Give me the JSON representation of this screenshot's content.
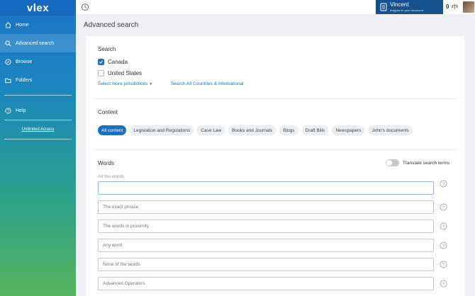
{
  "app": {
    "logo": "vlex"
  },
  "sidebar": {
    "items": [
      {
        "label": "Home",
        "icon": "home-icon"
      },
      {
        "label": "Advanced search",
        "icon": "search-icon",
        "active": true
      },
      {
        "label": "Browse",
        "icon": "compass-icon"
      },
      {
        "label": "Folders",
        "icon": "folder-icon"
      },
      {
        "label": "Help",
        "icon": "help-icon"
      }
    ],
    "unlimited_access": "Unlimited Access"
  },
  "header": {
    "user_name": "Vincent",
    "user_subtitle": "Insights on your document",
    "credits": "0"
  },
  "page_title": "Advanced search",
  "search": {
    "heading": "Search",
    "jurisdictions": [
      {
        "label": "Canada",
        "checked": true
      },
      {
        "label": "United States",
        "checked": false
      }
    ],
    "more_link": "Select more jurisdictions",
    "all_link": "Search All Countries & International"
  },
  "content": {
    "heading": "Content",
    "chips": [
      "All content",
      "Legislation and Regulations",
      "Case Law",
      "Books and Journals",
      "Blogs",
      "Draft Bills",
      "Newspapers",
      "John's documents"
    ]
  },
  "words": {
    "heading": "Words",
    "translate_label": "Translate search terms",
    "all_words_label": "All the words",
    "fields": [
      {
        "placeholder": ""
      },
      {
        "placeholder": "The exact phrase"
      },
      {
        "placeholder": "The words in proximity"
      },
      {
        "placeholder": "Any word"
      },
      {
        "placeholder": "None of the words"
      },
      {
        "placeholder": "Advanced Operators"
      }
    ]
  },
  "colors": {
    "primary": "#1f6fbf",
    "header_user_bg": "#17528f"
  }
}
